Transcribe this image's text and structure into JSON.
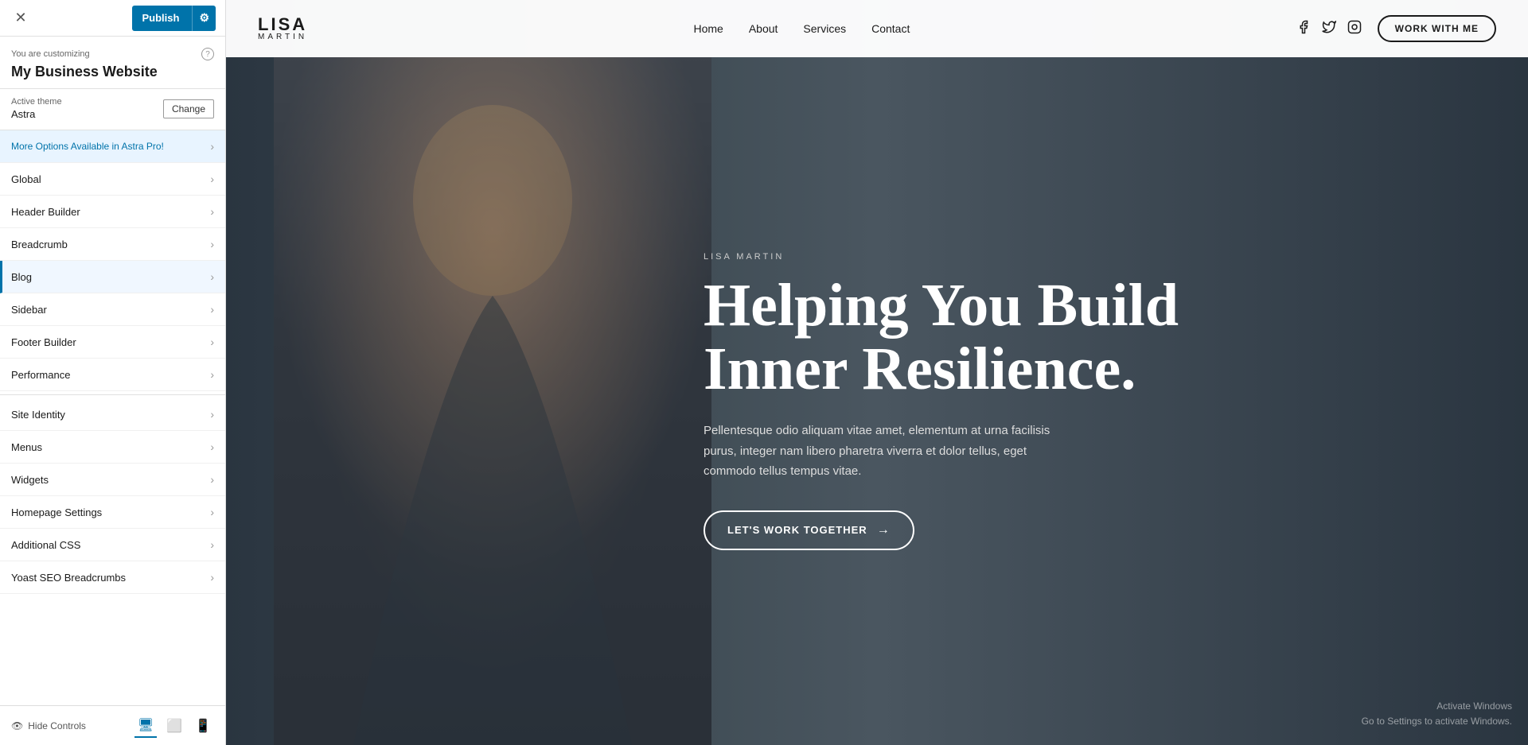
{
  "panel": {
    "close_icon": "✕",
    "publish_label": "Publish",
    "gear_icon": "⚙",
    "customizing_label": "You are customizing",
    "site_name": "My Business Website",
    "help_icon": "?",
    "active_theme_label": "Active theme",
    "theme_name": "Astra",
    "change_button": "Change",
    "promo_item": "More Options Available in Astra Pro!",
    "menu_items": [
      {
        "label": "Global",
        "active": false
      },
      {
        "label": "Header Builder",
        "active": false
      },
      {
        "label": "Breadcrumb",
        "active": false
      },
      {
        "label": "Blog",
        "active": true
      },
      {
        "label": "Sidebar",
        "active": false
      },
      {
        "label": "Footer Builder",
        "active": false
      },
      {
        "label": "Performance",
        "active": false
      },
      {
        "label": "Site Identity",
        "active": false
      },
      {
        "label": "Menus",
        "active": false
      },
      {
        "label": "Widgets",
        "active": false
      },
      {
        "label": "Homepage Settings",
        "active": false
      },
      {
        "label": "Additional CSS",
        "active": false
      },
      {
        "label": "Yoast SEO Breadcrumbs",
        "active": false
      }
    ],
    "hide_controls": "Hide Controls",
    "device_desktop": "🖥",
    "device_tablet": "📱",
    "device_mobile": "📱"
  },
  "website": {
    "logo_name": "LISA",
    "logo_sub": "MARTIN",
    "nav_links": [
      "Home",
      "About",
      "Services",
      "Contact"
    ],
    "work_btn": "WORK WITH ME",
    "hero_tag": "LISA MARTIN",
    "hero_heading": "Helping You Build Inner Resilience.",
    "hero_body": "Pellentesque odio aliquam vitae amet, elementum at urna facilisis purus, integer nam libero pharetra viverra et dolor tellus, eget commodo tellus tempus vitae.",
    "hero_cta": "LET'S WORK TOGETHER",
    "activate_line1": "Activate Windows",
    "activate_line2": "Go to Settings to activate Windows."
  }
}
